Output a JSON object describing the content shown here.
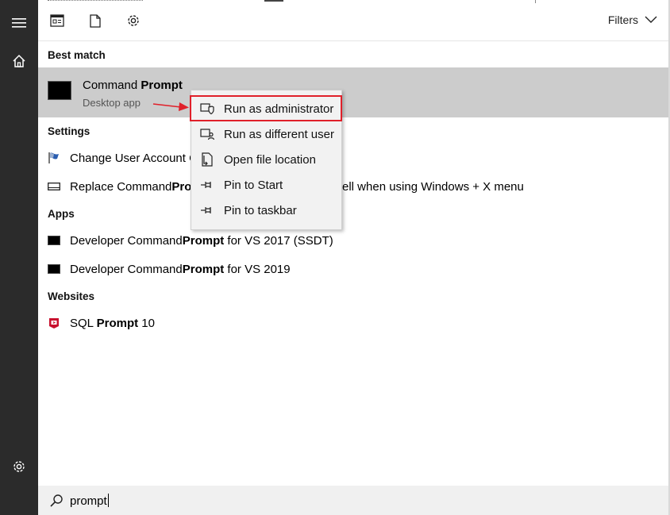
{
  "toolbar": {
    "filters_label": "Filters",
    "icons": [
      "news-icon",
      "document-icon",
      "settings-icon"
    ]
  },
  "rail": {
    "icons": [
      "hamburger-menu-icon",
      "home-icon",
      "settings-icon"
    ]
  },
  "sections": {
    "best_match": "Best match",
    "settings": "Settings",
    "apps": "Apps",
    "websites": "Websites"
  },
  "best_match": {
    "title_plain": "Command ",
    "title_bold": "Prompt",
    "subtitle": "Desktop app"
  },
  "settings_items": [
    {
      "plain": "Change User Account C",
      "bold": "",
      "rest": "",
      "icon": "uac-flag-icon"
    },
    {
      "plain": "Replace Command ",
      "bold": "Pro",
      "rest": "",
      "tail": "ell when using Windows + X menu",
      "icon": "taskbar-icon"
    }
  ],
  "apps_items": [
    {
      "plain": "Developer Command ",
      "bold": "Prompt",
      "rest": " for VS 2017 (SSDT)",
      "icon": "cmd-icon"
    },
    {
      "plain": "Developer Command ",
      "bold": "Prompt",
      "rest": " for VS 2019",
      "icon": "cmd-icon"
    }
  ],
  "website_items": [
    {
      "plain": "SQL ",
      "bold": "Prompt",
      "rest": " 10",
      "icon": "sql-prompt-icon"
    }
  ],
  "context_menu": [
    {
      "label": "Run as administrator",
      "icon": "shield-admin-icon",
      "highlighted": true
    },
    {
      "label": "Run as different user",
      "icon": "user-switch-icon"
    },
    {
      "label": "Open file location",
      "icon": "file-location-icon"
    },
    {
      "label": "Pin to Start",
      "icon": "pin-icon"
    },
    {
      "label": "Pin to taskbar",
      "icon": "pin-icon"
    }
  ],
  "search": {
    "query": "prompt"
  },
  "colors": {
    "rail": "#2b2b2b",
    "selection": "#cccccc",
    "highlight_box": "#e0202a",
    "search_bg": "#f0f0f0"
  }
}
